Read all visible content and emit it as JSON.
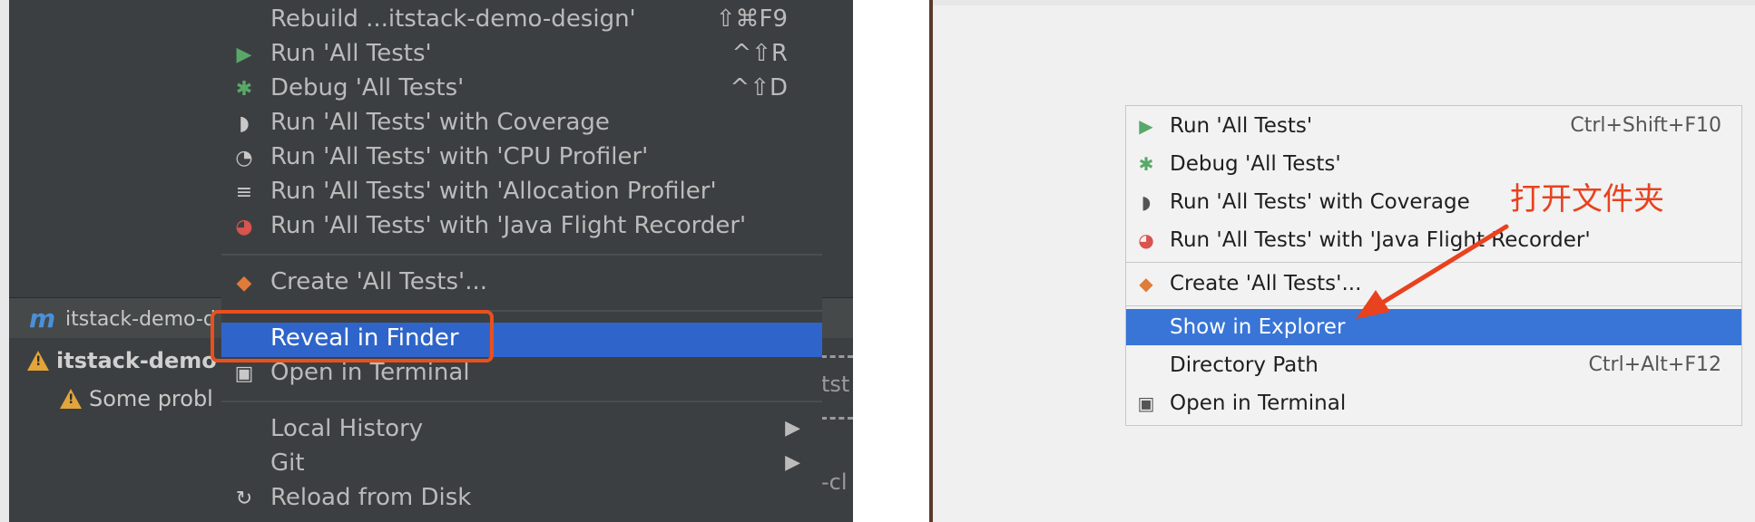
{
  "left_panel": {
    "tab_label": "itstack-demo-d",
    "tree": [
      {
        "text": "itstack-demo",
        "warning": true
      },
      {
        "text": "Some probl",
        "warning": true
      }
    ],
    "bg_fragments": [
      "tst",
      "-cl"
    ],
    "menu": {
      "items": [
        {
          "label": "Rebuild ...itstack-demo-design'",
          "shortcut": "⇧⌘F9",
          "icon": "none"
        },
        {
          "label": "Run 'All Tests'",
          "shortcut": "^⇧R",
          "icon": "run-icon"
        },
        {
          "label": "Debug 'All Tests'",
          "shortcut": "^⇧D",
          "icon": "debug-bug-icon"
        },
        {
          "label": "Run 'All Tests' with Coverage",
          "shortcut": "",
          "icon": "coverage-icon"
        },
        {
          "label": "Run 'All Tests' with 'CPU Profiler'",
          "shortcut": "",
          "icon": "cpu-profiler-icon"
        },
        {
          "label": "Run 'All Tests' with 'Allocation Profiler'",
          "shortcut": "",
          "icon": "allocation-profiler-icon"
        },
        {
          "label": "Run 'All Tests' with 'Java Flight Recorder'",
          "shortcut": "",
          "icon": "flight-recorder-icon"
        },
        {
          "label": "Create 'All Tests'...",
          "shortcut": "",
          "icon": "create-config-icon"
        },
        {
          "label": "Reveal in Finder",
          "shortcut": "",
          "icon": "none",
          "selected": true
        },
        {
          "label": "Open in Terminal",
          "shortcut": "",
          "icon": "terminal-icon"
        },
        {
          "label": "Local History",
          "shortcut": "",
          "icon": "none",
          "submenu": true
        },
        {
          "label": "Git",
          "shortcut": "",
          "icon": "none",
          "submenu": true
        },
        {
          "label": "Reload from Disk",
          "shortcut": "",
          "icon": "reload-icon"
        }
      ]
    }
  },
  "right_panel": {
    "menu": {
      "items": [
        {
          "label": "Run 'All Tests'",
          "shortcut": "Ctrl+Shift+F10",
          "icon": "run-icon"
        },
        {
          "label": "Debug 'All Tests'",
          "shortcut": "",
          "icon": "debug-bug-icon"
        },
        {
          "label": "Run 'All Tests' with Coverage",
          "shortcut": "",
          "icon": "coverage-icon"
        },
        {
          "label": "Run 'All Tests' with 'Java Flight Recorder'",
          "shortcut": "",
          "icon": "flight-recorder-icon"
        },
        {
          "label": "Create 'All Tests'...",
          "shortcut": "",
          "icon": "create-config-icon"
        },
        {
          "label": "Show in Explorer",
          "shortcut": "",
          "icon": "none",
          "selected": true
        },
        {
          "label": "Directory Path",
          "shortcut": "Ctrl+Alt+F12",
          "icon": "none"
        },
        {
          "label": "Open in Terminal",
          "shortcut": "",
          "icon": "terminal-icon"
        }
      ]
    },
    "annotation": "打开文件夹"
  },
  "colors": {
    "dark_menu_bg": "#3c3f41",
    "dark_selection": "#2f65ca",
    "light_selection": "#3875d7",
    "highlight_box": "#e8501f",
    "annotation": "#e8421e",
    "run_green": "#59a869",
    "flight_red": "#d9534f"
  }
}
